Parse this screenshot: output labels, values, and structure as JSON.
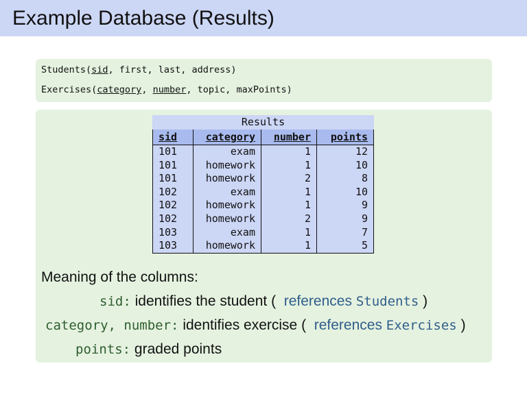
{
  "title": "Example Database (Results)",
  "schemas": {
    "students": {
      "name": "Students(",
      "key": "sid",
      "rest": ", first, last, address)"
    },
    "exercises": {
      "name": "Exercises(",
      "key1": "category",
      "sep": ", ",
      "key2": "number",
      "rest": ", topic, maxPoints)"
    }
  },
  "results_table": {
    "caption": "Results",
    "columns": [
      "sid",
      "category",
      "number",
      "points"
    ],
    "rows": [
      [
        "101",
        "exam",
        "1",
        "12"
      ],
      [
        "101",
        "homework",
        "1",
        "10"
      ],
      [
        "101",
        "homework",
        "2",
        "8"
      ],
      [
        "102",
        "exam",
        "1",
        "10"
      ],
      [
        "102",
        "homework",
        "1",
        "9"
      ],
      [
        "102",
        "homework",
        "2",
        "9"
      ],
      [
        "103",
        "exam",
        "1",
        "7"
      ],
      [
        "103",
        "homework",
        "1",
        "5"
      ]
    ]
  },
  "meaning": {
    "heading": "Meaning of the columns:",
    "lines": [
      {
        "key": "sid",
        "colon": ":",
        "text": " identifies the student (",
        "ref_word": "references",
        "ref_target": "Students",
        "close": " )"
      },
      {
        "key": "category, number",
        "colon": ":",
        "text": " identifies exercise (",
        "ref_word": "references",
        "ref_target": "Exercises",
        "close": " )"
      },
      {
        "key": "points",
        "colon": ":",
        "text": " graded points"
      }
    ]
  },
  "colors": {
    "title_bar": "#ccd6f5",
    "block_background": "#e5f2e0",
    "table_header": "#a9bbee",
    "table_body": "#ccd6f5",
    "key_text": "#2e5e2e",
    "reference_text": "#2f5d8a"
  }
}
